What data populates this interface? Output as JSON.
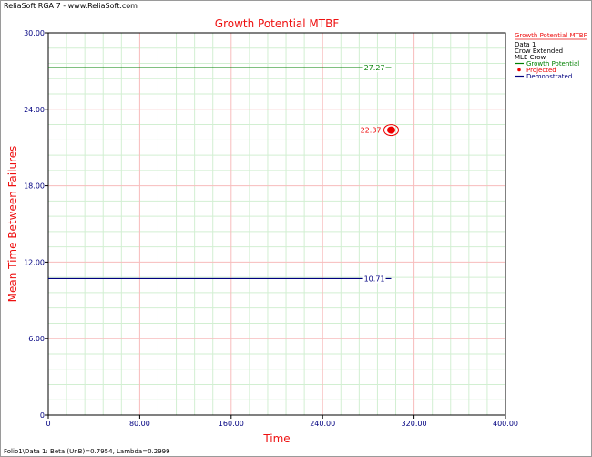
{
  "app": {
    "title": "ReliaSoft RGA 7 - www.ReliaSoft.com"
  },
  "footer": {
    "text": "Folio1\\Data 1: Beta (UnB)=0.7954, Lambda=0.2999"
  },
  "colors": {
    "title": "#ee1111",
    "axis_label": "#ee1111",
    "tick_label": "#000080",
    "major_grid": "#f7bcbc",
    "minor_grid": "#d2efd2",
    "growth_potential": "#008000",
    "projected": "#ee0000",
    "demonstrated": "#000080"
  },
  "chart_data": {
    "type": "line",
    "title": "Growth Potential MTBF",
    "xlabel": "Time",
    "ylabel": "Mean Time Between Failures",
    "xlim": [
      0,
      400
    ],
    "ylim": [
      0,
      30
    ],
    "xticks": [
      "0",
      "80.00",
      "160.00",
      "240.00",
      "320.00",
      "400.00"
    ],
    "yticks": [
      "0",
      "6.00",
      "12.00",
      "18.00",
      "24.00",
      "30.00"
    ],
    "grid": true,
    "legend": {
      "placement": "top-right, outside plot",
      "title": "Growth Potential MTBF",
      "header_lines": [
        "Data 1",
        "Crow Extended",
        "MLE Crow"
      ],
      "entries": [
        {
          "label": "Growth Potential",
          "marker": "line",
          "color_key": "growth_potential"
        },
        {
          "label": "Projected",
          "marker": "point",
          "color_key": "projected"
        },
        {
          "label": "Demonstrated",
          "marker": "line",
          "color_key": "demonstrated"
        }
      ]
    },
    "series": [
      {
        "name": "Growth Potential",
        "kind": "hline",
        "y": 27.27,
        "x": [
          0,
          300
        ],
        "label": "27.27",
        "color_key": "growth_potential"
      },
      {
        "name": "Projected",
        "kind": "point",
        "x": 300,
        "y": 22.37,
        "label": "22.37",
        "color_key": "projected"
      },
      {
        "name": "Demonstrated",
        "kind": "hline",
        "y": 10.71,
        "x": [
          0,
          300
        ],
        "label": "10.71",
        "color_key": "demonstrated"
      }
    ]
  }
}
